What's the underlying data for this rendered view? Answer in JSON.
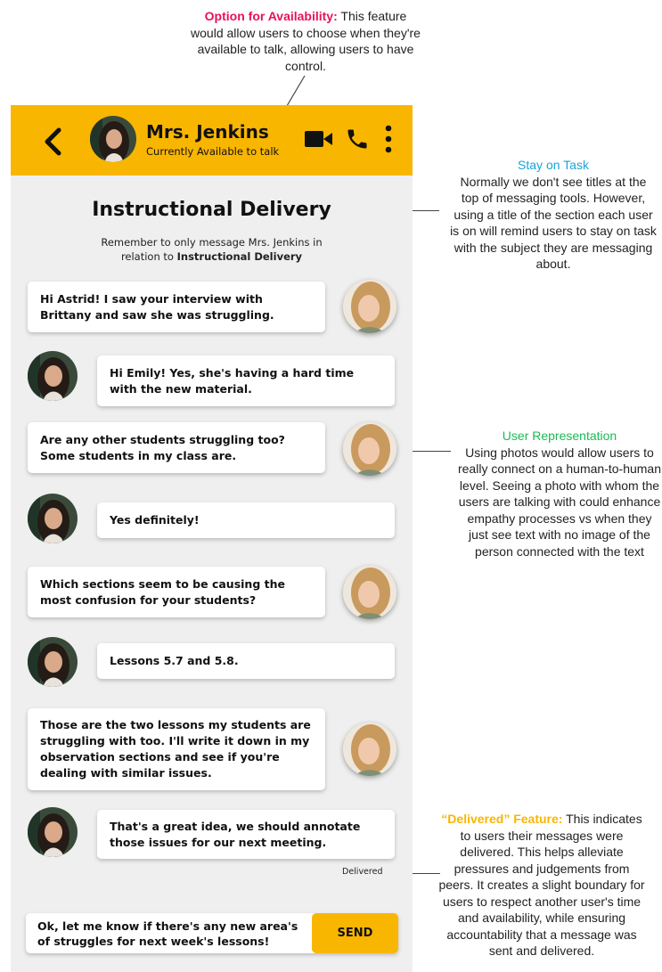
{
  "annotations": {
    "availability": {
      "heading": "Option for Availability:",
      "text": " This feature would allow users to choose when they're available to talk, allowing users to have control.",
      "color": "#e8115b"
    },
    "stay_on_task": {
      "heading": "Stay on Task",
      "text": "Normally we don't see titles at the top of messaging tools. However, using a title of the section each user is on will remind users to stay on task with the subject they are messaging about.",
      "color": "#1aa3d8"
    },
    "user_representation": {
      "heading": "User Representation",
      "text": "Using photos would allow users to really connect on a human-to-human level. Seeing a photo with whom the users are talking with could enhance empathy processes vs when they just see text with no image of the person connected with the text",
      "color": "#1db954"
    },
    "delivered_feature": {
      "heading": "“Delivered” Feature:",
      "text": " This indicates to users their messages were delivered. This helps alleviate pressures and judgements from peers. It creates a slight boundary for users to respect another user's time and availability, while ensuring accountability that a message was sent and delivered.",
      "color": "#f9b600"
    }
  },
  "header": {
    "name": "Mrs. Jenkins",
    "status": "Currently Available to talk",
    "color": "#f9b600",
    "icons": [
      "chevron-left-icon",
      "video-icon",
      "phone-icon",
      "more-vertical-icon"
    ]
  },
  "chat": {
    "title": "Instructional Delivery",
    "reminder_prefix": "Remember to only message Mrs. Jenkins in relation to ",
    "reminder_topic": "Instructional Delivery",
    "messages": [
      {
        "from": "Emily",
        "text": "Hi Astrid! I saw your interview with Brittany and saw she was struggling."
      },
      {
        "from": "Astrid",
        "text": "Hi Emily! Yes, she's having a hard time with the new material."
      },
      {
        "from": "Emily",
        "text": "Are any other students struggling too? Some students in my class are."
      },
      {
        "from": "Astrid",
        "text": "Yes definitely!"
      },
      {
        "from": "Emily",
        "text": "Which sections seem to be causing the most confusion for your students?"
      },
      {
        "from": "Astrid",
        "text": "Lessons 5.7 and 5.8."
      },
      {
        "from": "Emily",
        "text": "Those are the two lessons my students are struggling with too. I'll write it down in my observation sections and see if you're dealing with similar issues."
      },
      {
        "from": "Astrid",
        "text": "That's a great idea, we should annotate those issues for our next meeting."
      }
    ],
    "delivered": "Delivered",
    "composer_text": "Ok, let me know if there's any new area's of struggles for next week's lessons!",
    "send": "SEND"
  }
}
